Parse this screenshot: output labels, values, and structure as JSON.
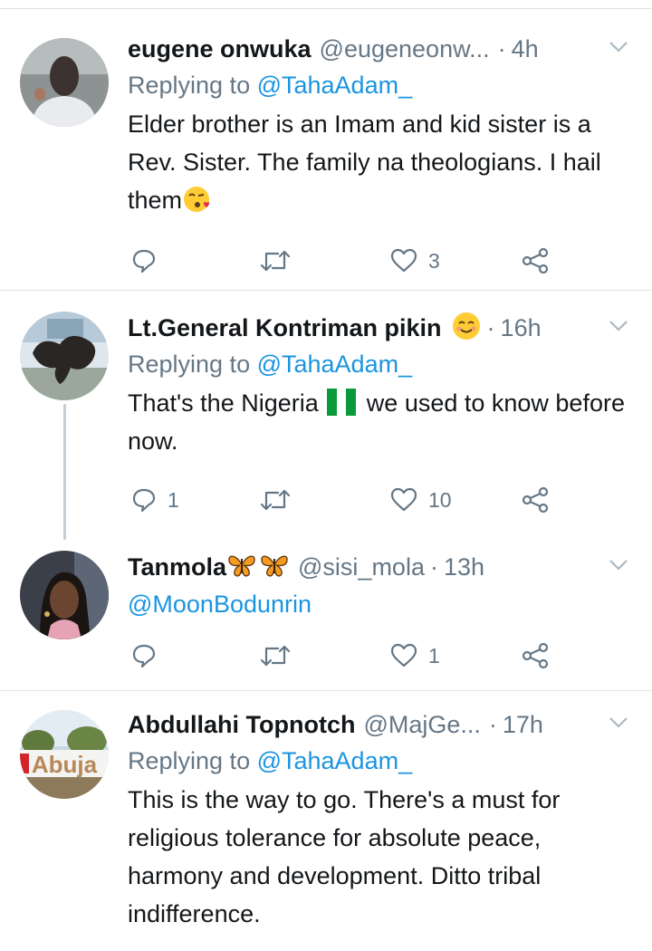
{
  "tweets": [
    {
      "name": "eugene onwuka",
      "handle": "@eugeneonw...",
      "sep": "·",
      "time": "4h",
      "replying_prefix": "Replying to ",
      "replying_to": "@TahaAdam_",
      "text": "Elder brother is an Imam and kid sister is a Rev. Sister. The family na theologians. I hail them",
      "emoji": "face-blowing-kiss",
      "replies": "",
      "likes": "3"
    },
    {
      "name": "Lt.General Kontriman pikin",
      "name_emoji": "smiling-face",
      "sep": "·",
      "time": "16h",
      "replying_prefix": "Replying to ",
      "replying_to": "@TahaAdam_",
      "text_a": "That's the Nigeria",
      "flag": "nigeria-flag",
      "text_b": "we used to know before now.",
      "replies": "1",
      "likes": "10"
    },
    {
      "name": "Tanmola",
      "name_emoji": "butterfly",
      "handle": "@sisi_mola",
      "sep": "·",
      "time": "13h",
      "text": "@MoonBodunrin",
      "replies": "",
      "likes": "1"
    },
    {
      "name": "Abdullahi Topnotch",
      "handle": "@MajGe...",
      "sep": "·",
      "time": "17h",
      "replying_prefix": "Replying to ",
      "replying_to": "@TahaAdam_",
      "text": "This is the way to go. There's a must for religious tolerance for absolute peace, harmony and development. Ditto tribal indifference.",
      "avatar_text": "Abuja"
    }
  ],
  "icons": {
    "reply": "reply-icon",
    "retweet": "retweet-icon",
    "like": "heart-icon",
    "share": "share-icon",
    "more": "chevron-down-icon"
  },
  "colors": {
    "text": "#14171a",
    "muted": "#657786",
    "link": "#1b95e0",
    "divider": "#e1e6ea"
  }
}
